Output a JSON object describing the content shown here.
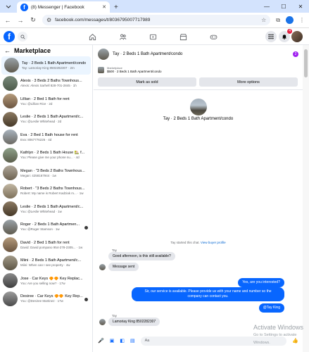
{
  "browser": {
    "tab_title": "(8) Messenger | Facebook",
    "url": "facebook.com/messages/t/8036795007717989"
  },
  "fb_header": {
    "notification_count": "4"
  },
  "sidebar": {
    "title": "Marketplace",
    "conversations": [
      {
        "name": "Tay · 2 Beds 1 Bath Apartment/condo",
        "preview": "Tay: Lamoriay King 8502282307 · 2m",
        "color": "linear-gradient(180deg,#9aa3a9,#5f5a4e)",
        "active": true
      },
      {
        "name": "Alexis · 3 Beds 2 Baths Townhous...",
        "preview": "Alexis: Alexis Sarhell 828-701-2845 · 1h",
        "color": "linear-gradient(180deg,#7a8b7c,#4d5a4a)"
      },
      {
        "name": "Lillian · 2 Bed 1 Bath for rent",
        "preview": "You: @Lillian Rice · 2d",
        "color": "linear-gradient(180deg,#b59b7c,#6b5540)"
      },
      {
        "name": "Leslie · 2 Beds 1 Bath Apartment/c...",
        "preview": "You: @Leslie Whitehead · 2d",
        "color": "linear-gradient(180deg,#8c7a62,#453828)"
      },
      {
        "name": "Eva · 2 Bed 1 Bath house for rent",
        "preview": "Eva: 8067776226 · 4d",
        "color": "linear-gradient(180deg,#a9b4be,#6c6a64)"
      },
      {
        "name": "Kathlyn · 2 Beds 1 Bath House 🏡 f...",
        "preview": "You: Please give me your phone nu... · 4d",
        "color": "linear-gradient(180deg,#8fa28a,#5b5e4b)"
      },
      {
        "name": "Megan · \"3 Beds 2 Baths Townhous...",
        "preview": "Megan: 4258167944 · 1w",
        "color": "linear-gradient(180deg,#b0a89a,#6d6250)"
      },
      {
        "name": "Robert · \"3 Beds 2 Baths Townhous...",
        "preview": "Robert: My name is Robert Kadziak m... · 1w",
        "color": "linear-gradient(180deg,#c2b7a3,#7d705a)"
      },
      {
        "name": "Leslie · 2 Beds 1 Bath Apartment/c...",
        "preview": "You: @Leslie Whitehead · 1w",
        "color": "linear-gradient(180deg,#8c7a62,#453828)"
      },
      {
        "name": "Roger · 2 Beds 1 Bath Apartmen...",
        "preview": "You: @Roger Stamson · 1w",
        "color": "linear-gradient(180deg,#9aa3a9,#5f5a4e)",
        "end_dot": true
      },
      {
        "name": "David · 2 Bed 1 Bath for rent",
        "preview": "David: David pompano 954-278-2305... · 1w",
        "color": "linear-gradient(180deg,#b59b7c,#6b5540)"
      },
      {
        "name": "Miini · 2 Beds 1 Bath Apartment/c...",
        "preview": "Miini: When can I see property · 4w",
        "color": "linear-gradient(180deg,#a29a88,#5d5545)"
      },
      {
        "name": "Jose · Car Keys 🔶🔶 Key Replac...",
        "preview": "You: Are you selling now? · 17w",
        "color": "linear-gradient(180deg,#8b8b8b,#3d3d3d)"
      },
      {
        "name": "Desiree · Car Keys 🔶🔶 Key Rep...",
        "preview": "You: @Desiree Martinez · 17w",
        "color": "linear-gradient(180deg,#9d9d9d,#4a4a4a)",
        "end_dot": true
      }
    ]
  },
  "chat": {
    "header_title": "Tay · 2 Beds 1 Bath Apartment/condo",
    "header_badge": "2",
    "listing_label": "Marketplace",
    "listing_price": "$500 · 2 Beds 1 Bath Apartment/condo",
    "mark_sold": "Mark as sold",
    "more_options": "More options",
    "center_title": "Tay · 2 Beds 1 Bath Apartment/condo",
    "started_text": "Tay started this chat.",
    "started_link": "View buyer profile",
    "sender_name_1": "Tay",
    "msg_1": "Good afternoon, is this still available?",
    "msg_2": "Message sent",
    "msg_3": "Yes, are you interested?",
    "msg_4a": "Sir, our service is available. Please provide us with your name and number so the",
    "msg_4b": "company can contact you.",
    "msg_5": "@Tay King",
    "sender_name_2": "Tay",
    "msg_6": "Lamoriay King 8502282307",
    "composer_placeholder": "Aa"
  },
  "watermark": {
    "line1": "Activate Windows",
    "line2": "Go to Settings to activate Windows."
  }
}
